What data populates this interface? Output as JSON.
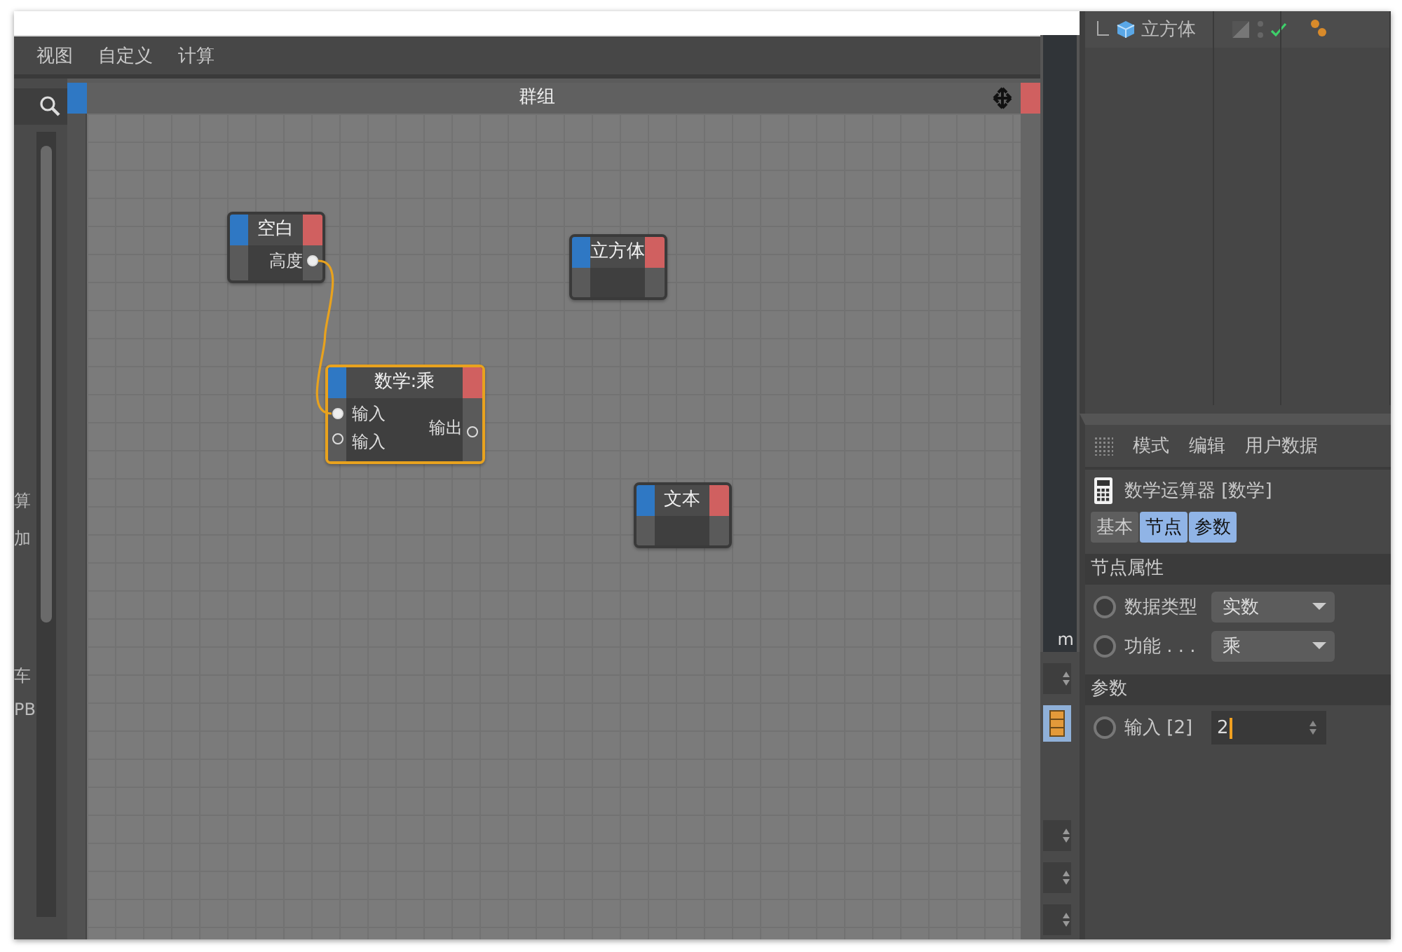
{
  "menu_bar": {
    "items": [
      "视图",
      "自定义",
      "计算"
    ]
  },
  "left_strip": {
    "labels": [
      "算",
      "加",
      "车",
      "PB"
    ]
  },
  "node_editor": {
    "title": "群组",
    "nodes": [
      {
        "title": "空白",
        "selected": false,
        "outputs": [
          {
            "label": "高度",
            "connected": true
          }
        ]
      },
      {
        "title": "立方体",
        "selected": false
      },
      {
        "title": "数学:乘",
        "selected": true,
        "inputs": [
          {
            "label": "输入",
            "connected": true
          },
          {
            "label": "输入",
            "connected": false
          }
        ],
        "outputs": [
          {
            "label": "输出",
            "connected": false
          }
        ]
      },
      {
        "title": "文本",
        "selected": false
      }
    ]
  },
  "viewport_strip": {
    "unit_text": "m"
  },
  "object_manager": {
    "objects": [
      {
        "name": "立方体",
        "enabled": true
      }
    ]
  },
  "attributes": {
    "menu": [
      "模式",
      "编辑",
      "用户数据"
    ],
    "title": "数学运算器 [数学]",
    "tabs": [
      {
        "label": "基本",
        "selected": false
      },
      {
        "label": "节点",
        "selected": true
      },
      {
        "label": "参数",
        "selected": true
      }
    ],
    "sections": [
      {
        "title": "节点属性",
        "fields": [
          {
            "kind": "dropdown",
            "label": "数据类型",
            "value": "实数",
            "animated": false
          },
          {
            "kind": "dropdown",
            "label": "功能 . . .",
            "value": "乘",
            "animated": false
          }
        ]
      },
      {
        "title": "参数",
        "fields": [
          {
            "kind": "number",
            "label": "输入 [2]",
            "value": "2",
            "animated": false
          }
        ]
      }
    ]
  }
}
